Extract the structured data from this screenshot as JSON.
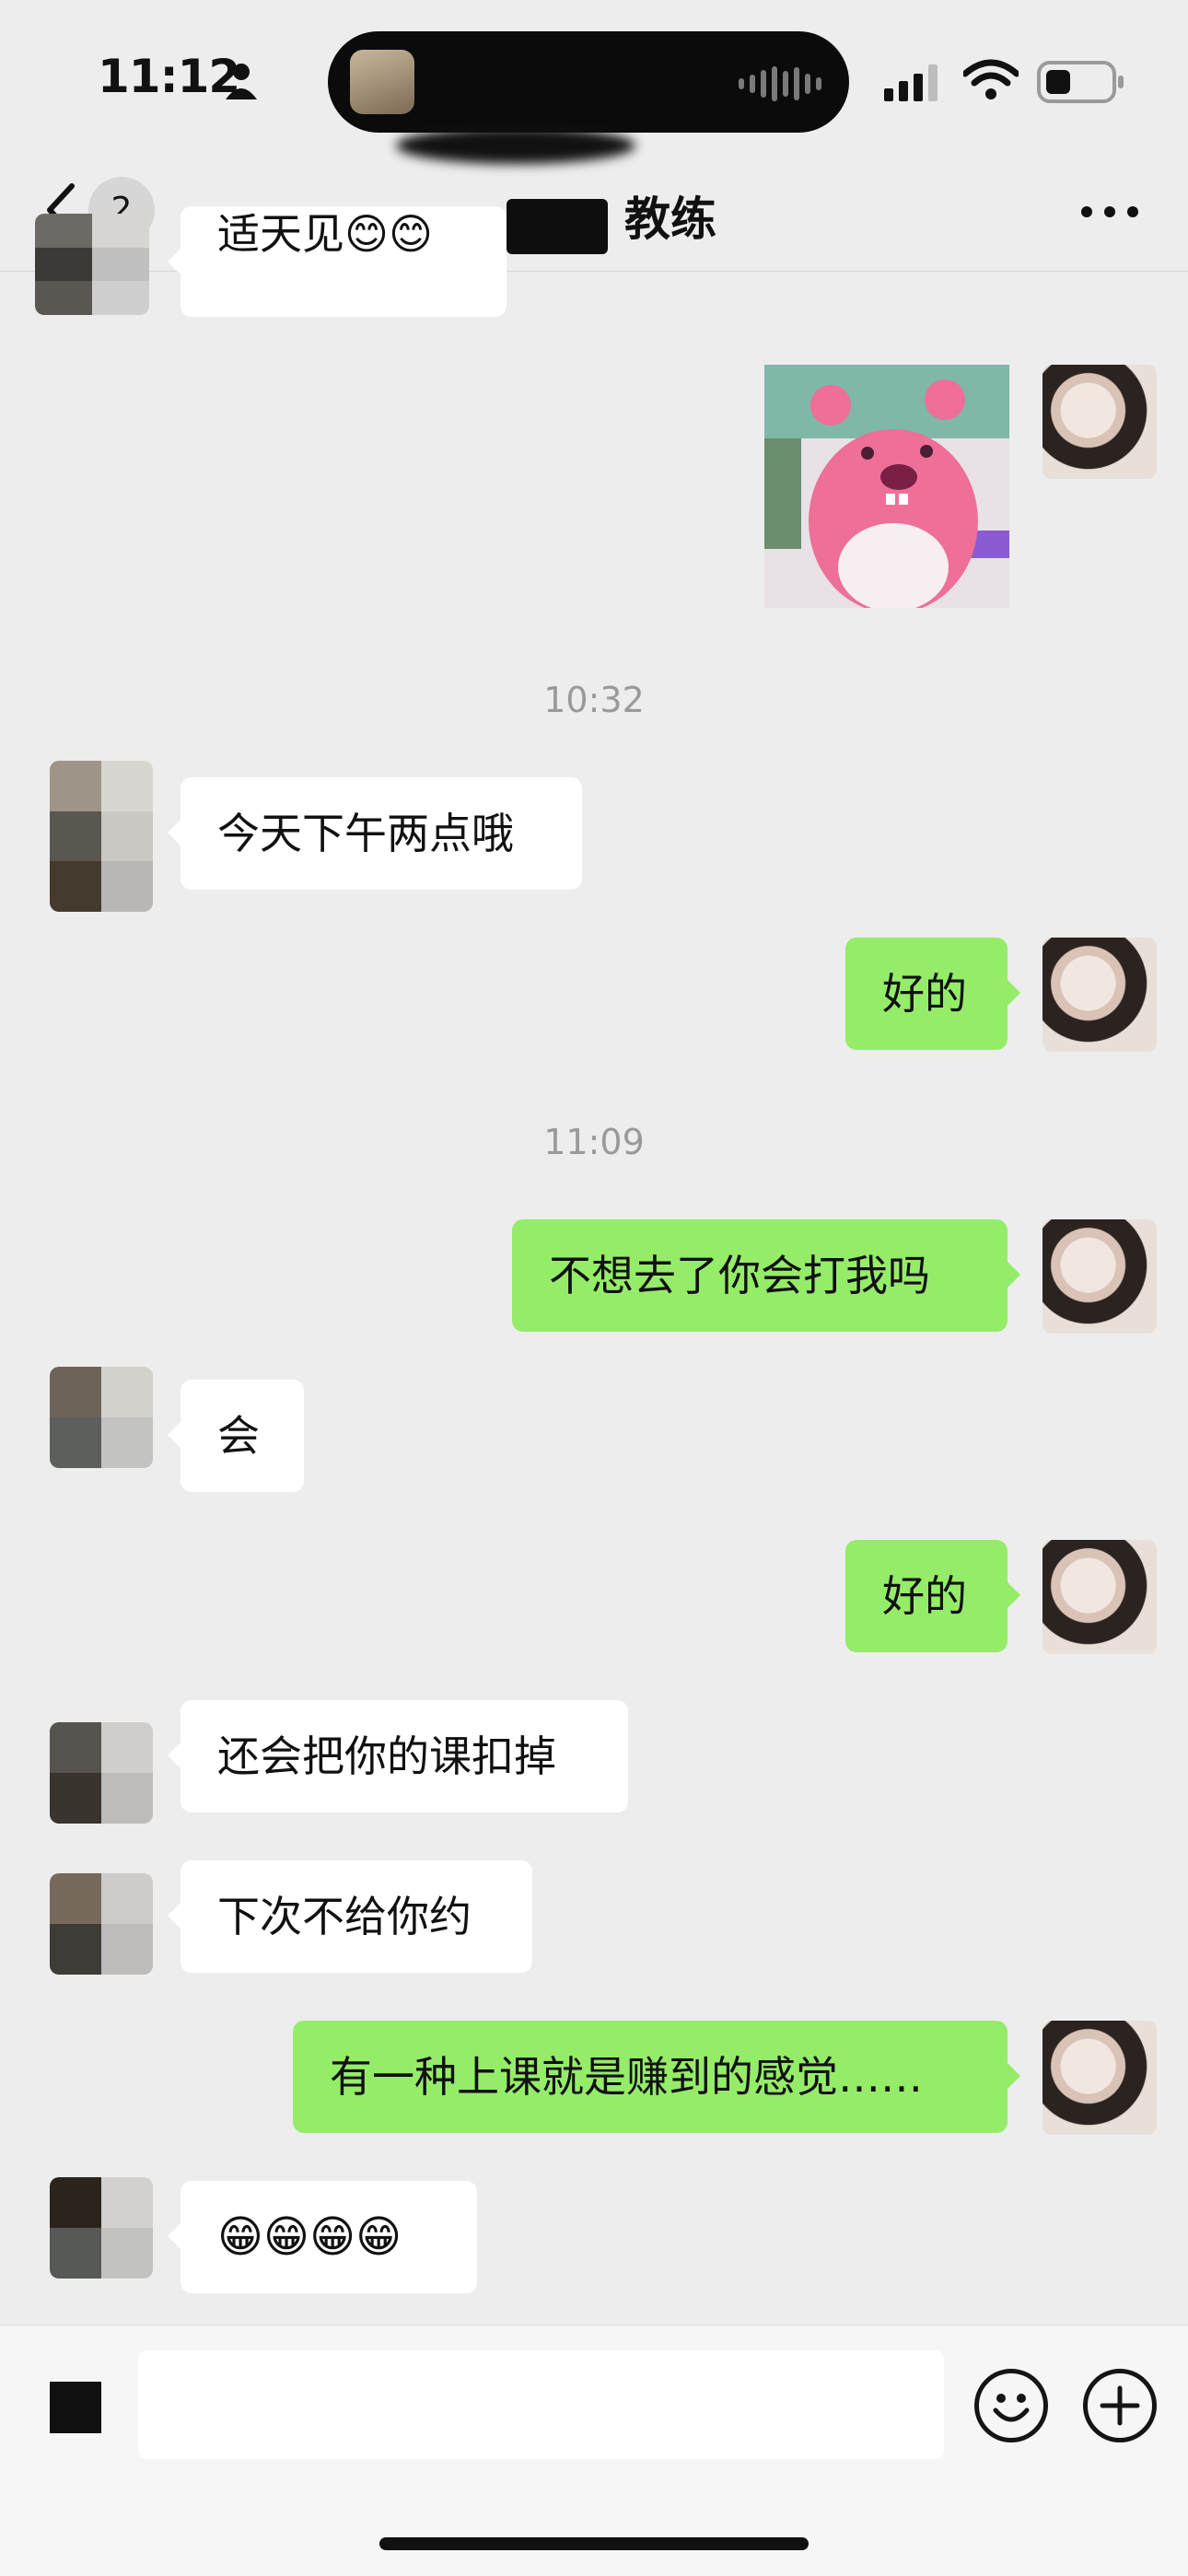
{
  "status_bar": {
    "time": "11:12"
  },
  "nav": {
    "back_count": "2",
    "title": "教练"
  },
  "messages": [
    {
      "id": "m0",
      "text": "适天见😊😊"
    },
    {
      "id": "ts1",
      "text": "10:32"
    },
    {
      "id": "m1",
      "text": "今天下午两点哦"
    },
    {
      "id": "m2",
      "text": "好的"
    },
    {
      "id": "ts2",
      "text": "11:09"
    },
    {
      "id": "m3",
      "text": "不想去了你会打我吗"
    },
    {
      "id": "m4",
      "text": "会"
    },
    {
      "id": "m5",
      "text": "好的"
    },
    {
      "id": "m6",
      "text": "还会把你的课扣掉"
    },
    {
      "id": "m7",
      "text": "下次不给你约"
    },
    {
      "id": "m8",
      "text": "有一种上课就是赚到的感觉……"
    },
    {
      "id": "m9",
      "text": "😁😁😁😁"
    }
  ],
  "colors": {
    "sent_bubble": "#95ec69",
    "received_bubble": "#ffffff",
    "background": "#ededed"
  }
}
